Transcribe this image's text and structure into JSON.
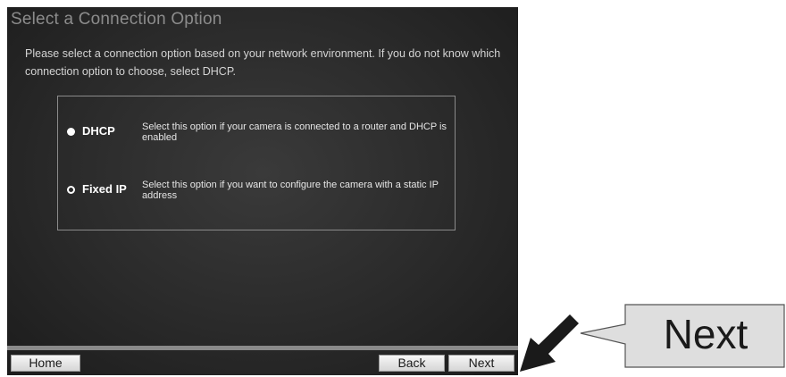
{
  "dialog": {
    "title": "Select a Connection Option",
    "intro": "Please select a connection option based on your network environment. If you do not know which connection option to choose, select DHCP."
  },
  "options": [
    {
      "label": "DHCP",
      "description": "Select this option if your camera is connected to a router and DHCP is enabled",
      "selected": true
    },
    {
      "label": "Fixed IP",
      "description": "Select this option if you want to configure the camera with a static IP address",
      "selected": false
    }
  ],
  "footer": {
    "home_label": "Home",
    "back_label": "Back",
    "next_label": "Next"
  },
  "callout": {
    "text": "Next",
    "icon": "pointer-arrow-icon"
  },
  "colors": {
    "panel_bg": "#2a2a2a",
    "title": "#8c8c8c",
    "text": "#d4d4d4",
    "callout_bg": "#dedede"
  }
}
